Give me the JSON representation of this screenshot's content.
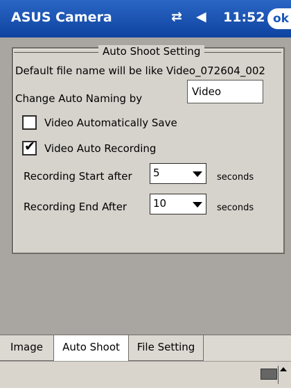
{
  "titlebar": {
    "app_title": "ASUS Camera",
    "time": "11:52",
    "ok_label": "ok",
    "conn_glyph": "⇄",
    "volume_glyph": "◀"
  },
  "settings": {
    "group_title": "Auto Shoot Setting",
    "default_file_text": "Default file name will be like  Video_072604_002",
    "change_naming_label": "Change Auto Naming by",
    "naming_value": "Video",
    "auto_save_label": "Video Automatically Save",
    "auto_save_checked": false,
    "auto_recording_label": "Video Auto Recording",
    "auto_recording_checked": true,
    "start_label": "Recording Start after",
    "start_value": "5",
    "end_label": "Recording End After",
    "end_value": "10",
    "seconds_label": "seconds",
    "check_glyph": "✔"
  },
  "tabs": [
    "Image",
    "Auto Shoot",
    "File Setting"
  ],
  "active_tab": "Auto Shoot",
  "icons": {
    "keyboard": "keyboard-icon"
  }
}
